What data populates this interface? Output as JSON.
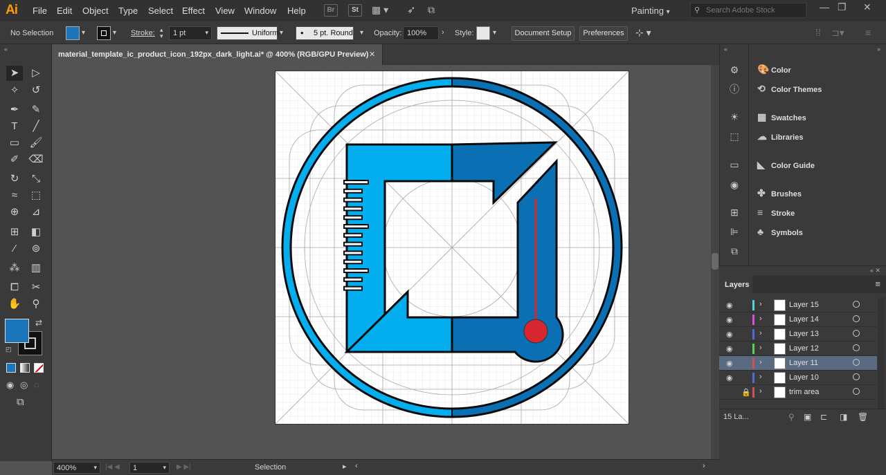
{
  "app": {
    "logo": "Ai"
  },
  "menu": [
    "File",
    "Edit",
    "Object",
    "Type",
    "Select",
    "Effect",
    "View",
    "Window",
    "Help"
  ],
  "menu_icons": {
    "bridge": "Br",
    "stock": "St"
  },
  "workspace": "Painting",
  "search_placeholder": "Search Adobe Stock",
  "control": {
    "selection": "No Selection",
    "stroke_label": "Stroke:",
    "stroke_weight": "1 pt",
    "profile": "Uniform",
    "brush": "5 pt. Round",
    "opacity_label": "Opacity:",
    "opacity": "100%",
    "style_label": "Style:",
    "document_setup": "Document Setup",
    "preferences": "Preferences"
  },
  "document": {
    "tab_title": "material_template_ic_product_icon_192px_dark_light.ai* @ 400% (RGB/GPU Preview)"
  },
  "colors": {
    "fill": "#1b75bb",
    "light_blue": "#03aeef",
    "dark_blue": "#0b6fb3",
    "thermo_red": "#d7262f",
    "menu_bg": "#323232"
  },
  "statusbar": {
    "zoom": "400%",
    "page": "1",
    "tool": "Selection"
  },
  "panels": [
    {
      "label": "Color",
      "icon": "color-icon"
    },
    {
      "label": "Color Themes",
      "icon": "color-themes-icon"
    },
    {
      "label": "Swatches",
      "icon": "swatches-icon"
    },
    {
      "label": "Libraries",
      "icon": "libraries-icon"
    },
    {
      "label": "Color Guide",
      "icon": "color-guide-icon"
    },
    {
      "label": "Brushes",
      "icon": "brushes-icon"
    },
    {
      "label": "Stroke",
      "icon": "stroke-icon"
    },
    {
      "label": "Symbols",
      "icon": "symbols-icon"
    }
  ],
  "layers": {
    "title": "Layers",
    "count": "15 La...",
    "items": [
      {
        "name": "Layer 15",
        "color": "#4fd8d8",
        "visible": true,
        "selected": false
      },
      {
        "name": "Layer 14",
        "color": "#d84fd8",
        "visible": true,
        "selected": false
      },
      {
        "name": "Layer 13",
        "color": "#4f6ad8",
        "visible": true,
        "selected": false
      },
      {
        "name": "Layer 12",
        "color": "#4fd84f",
        "visible": true,
        "selected": false
      },
      {
        "name": "Layer 11",
        "color": "#d84f4f",
        "visible": true,
        "selected": true
      },
      {
        "name": "Layer 10",
        "color": "#4f6ad8",
        "visible": true,
        "selected": false
      },
      {
        "name": "trim area",
        "color": "#d84f4f",
        "visible": false,
        "selected": false
      }
    ]
  }
}
